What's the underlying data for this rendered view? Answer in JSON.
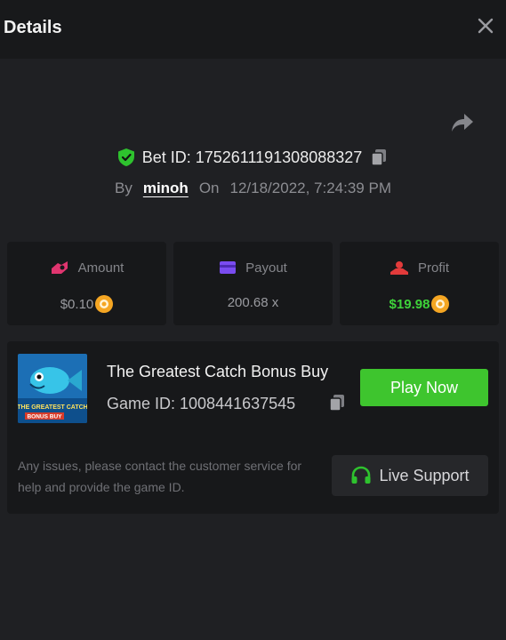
{
  "header": {
    "title": "Details"
  },
  "bet": {
    "id_label": "Bet ID: 1752611191308088327",
    "by_label": "By",
    "username": "minoh",
    "on_label": "On",
    "date": "12/18/2022, 7:24:39 PM"
  },
  "stats": [
    {
      "label": "Amount",
      "value": "$0.10",
      "icon": "amount-icon",
      "color": "#e0356f"
    },
    {
      "label": "Payout",
      "value": "200.68 x",
      "icon": "payout-icon",
      "color": "#7a4cf0"
    },
    {
      "label": "Profit",
      "value": "$19.98",
      "icon": "profit-icon",
      "color": "#e23b3b"
    }
  ],
  "game": {
    "title": "The Greatest Catch Bonus Buy",
    "game_id_label": "Game ID: 1008441637545",
    "thumbnail_text": "THE GREATEST CATCH BONUS BUY",
    "play_label": "Play Now",
    "help_text": "Any issues, please contact the customer service for help and provide the game ID.",
    "support_label": "Live Support"
  },
  "colors": {
    "accent_green": "#3ec52e",
    "profit_green": "#3ed33a",
    "coin": "#f5a623"
  }
}
